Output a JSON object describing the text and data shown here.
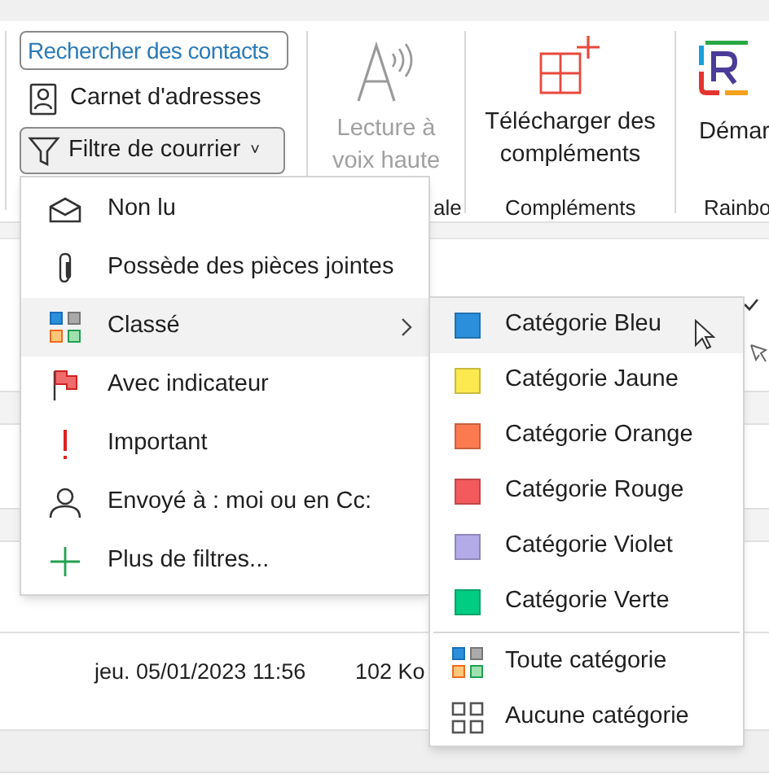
{
  "ribbon": {
    "search": {
      "placeholder": "Rechercher des contacts"
    },
    "address_book": {
      "label": "Carnet d'adresses"
    },
    "filter_button": {
      "label": "Filtre de courrier",
      "caret": "˅"
    },
    "read_aloud": {
      "label": "Lecture à voix haute",
      "disabled": true
    },
    "addins": {
      "label": "Télécharger des compléments"
    },
    "rainbow": {
      "label": "Démar"
    },
    "group_labels": [
      {
        "label": "ale"
      },
      {
        "label": "Compléments"
      },
      {
        "label": "Rainbo"
      }
    ]
  },
  "message_row": {
    "date": "jeu. 05/01/2023 11:56",
    "size": "102 Ko"
  },
  "filter_menu": [
    {
      "kind": "envelope",
      "label": "Non lu",
      "selected": false
    },
    {
      "kind": "paperclip",
      "label": "Possède des pièces jointes",
      "selected": false
    },
    {
      "kind": "categories",
      "label": "Classé",
      "selected": true,
      "submenu": true
    },
    {
      "kind": "flag",
      "label": "Avec indicateur",
      "selected": false
    },
    {
      "kind": "exclamation",
      "label": "Important",
      "selected": false
    },
    {
      "kind": "person",
      "label": "Envoyé à : moi ou en Cc:",
      "selected": false
    },
    {
      "kind": "plus",
      "label": "Plus de filtres...",
      "selected": false
    }
  ],
  "category_menu": [
    {
      "kind": "color",
      "label": "Catégorie Bleu",
      "color": "#2b8fdb",
      "selected": true
    },
    {
      "kind": "color",
      "label": "Catégorie Jaune",
      "color": "#fce94f",
      "selected": false
    },
    {
      "kind": "color",
      "label": "Catégorie Orange",
      "color": "#fb7a50",
      "selected": false
    },
    {
      "kind": "color",
      "label": "Catégorie Rouge",
      "color": "#f25a5d",
      "selected": false
    },
    {
      "kind": "color",
      "label": "Catégorie Violet",
      "color": "#b3aae8",
      "selected": false
    },
    {
      "kind": "color",
      "label": "Catégorie Verte",
      "color": "#00cc82",
      "selected": false
    },
    {
      "kind": "all",
      "label": "Toute catégorie",
      "selected": false
    },
    {
      "kind": "none",
      "label": "Aucune catégorie",
      "selected": false
    }
  ]
}
